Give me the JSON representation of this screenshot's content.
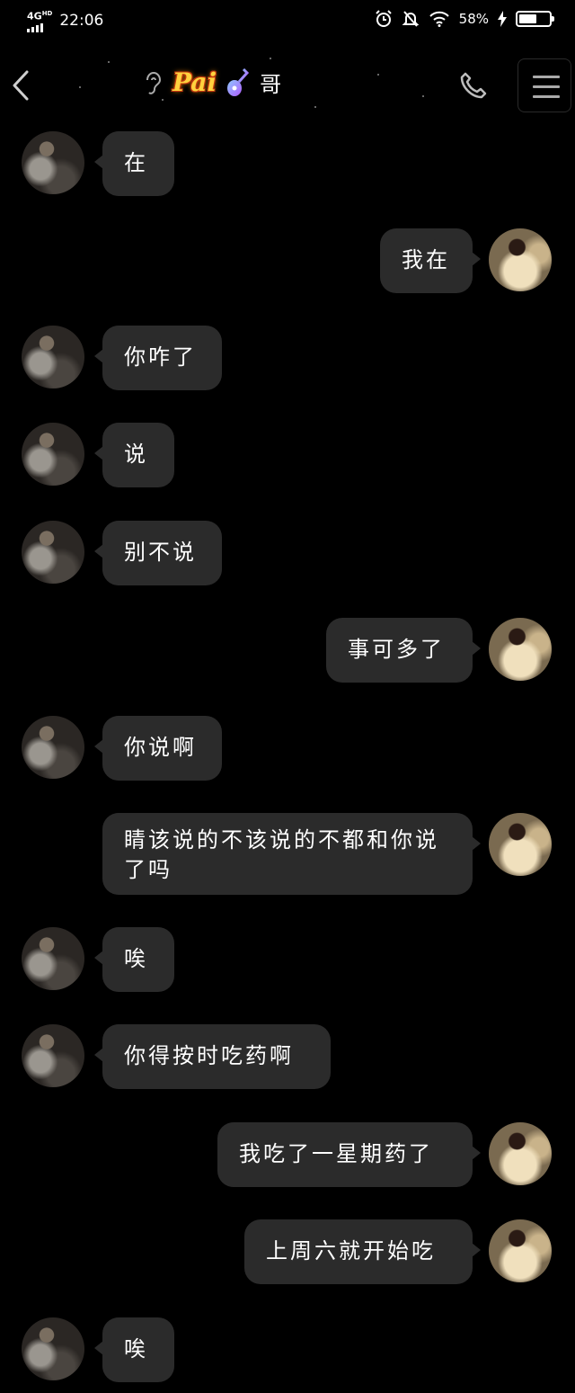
{
  "status_bar": {
    "network": "4G",
    "network_sup": "HD",
    "time": "22:06",
    "battery": "58%",
    "battery_level": 0.58
  },
  "header": {
    "logo_text": "Pai",
    "contact_name": "哥"
  },
  "messages": [
    {
      "from": "peer",
      "text": "在"
    },
    {
      "from": "self",
      "text": "我在"
    },
    {
      "from": "peer",
      "text": "你咋了"
    },
    {
      "from": "peer",
      "text": "说"
    },
    {
      "from": "peer",
      "text": "别不说"
    },
    {
      "from": "self",
      "text": "事可多了"
    },
    {
      "from": "peer",
      "text": "你说啊"
    },
    {
      "from": "self",
      "text": "睛该说的不该说的不都和你说了吗"
    },
    {
      "from": "peer",
      "text": "唉"
    },
    {
      "from": "peer",
      "text": "你得按时吃药啊"
    },
    {
      "from": "self",
      "text": "我吃了一星期药了"
    },
    {
      "from": "self",
      "text": "上周六就开始吃"
    },
    {
      "from": "peer",
      "text": "唉"
    }
  ],
  "colors": {
    "background": "#000000",
    "bubble": "#2b2b2b",
    "text": "#ffffff"
  }
}
